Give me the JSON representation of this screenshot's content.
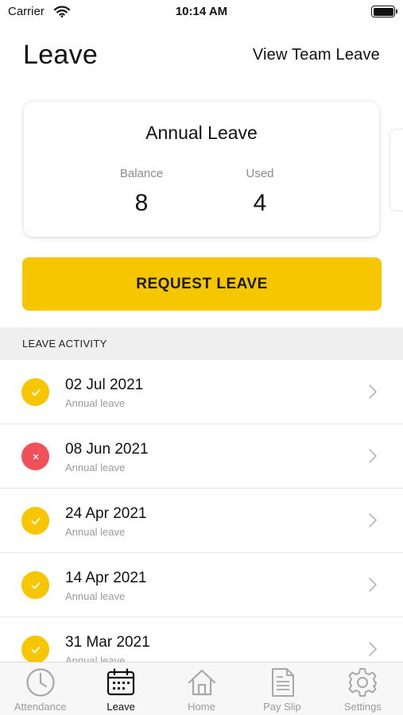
{
  "status_bar": {
    "carrier": "Carrier",
    "time": "10:14 AM"
  },
  "header": {
    "title": "Leave",
    "team_link": "View Team Leave"
  },
  "summary_card": {
    "title": "Annual Leave",
    "balance_label": "Balance",
    "balance_value": "8",
    "used_label": "Used",
    "used_value": "4"
  },
  "request_button": {
    "label": "REQUEST LEAVE"
  },
  "activity": {
    "header": "LEAVE ACTIVITY",
    "items": [
      {
        "date": "02 Jul 2021",
        "type": "Annual leave",
        "status": "approved"
      },
      {
        "date": "08 Jun 2021",
        "type": "Annual leave",
        "status": "rejected"
      },
      {
        "date": "24 Apr 2021",
        "type": "Annual leave",
        "status": "approved"
      },
      {
        "date": "14 Apr 2021",
        "type": "Annual leave",
        "status": "approved"
      },
      {
        "date": "31 Mar 2021",
        "type": "Annual leave",
        "status": "approved"
      }
    ]
  },
  "tab_bar": {
    "tabs": [
      {
        "label": "Attendance",
        "icon": "clock-icon",
        "active": false
      },
      {
        "label": "Leave",
        "icon": "calendar-icon",
        "active": true
      },
      {
        "label": "Home",
        "icon": "home-icon",
        "active": false
      },
      {
        "label": "Pay Slip",
        "icon": "payslip-icon",
        "active": false
      },
      {
        "label": "Settings",
        "icon": "gear-icon",
        "active": false
      }
    ]
  },
  "colors": {
    "accent": "#f6c700",
    "rejected": "#f0505a",
    "section_bg": "#efefef",
    "tab_inactive": "#9b9b9b"
  }
}
